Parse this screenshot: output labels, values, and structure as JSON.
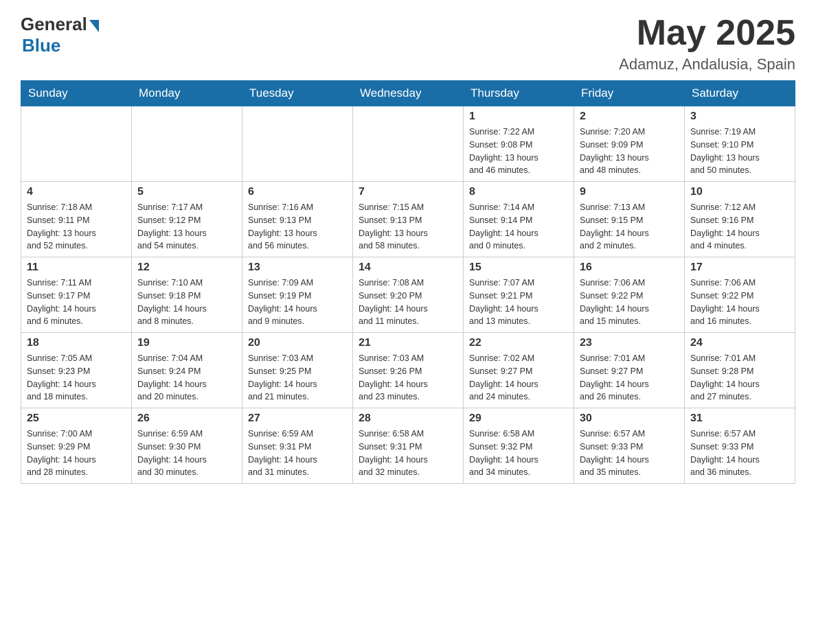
{
  "header": {
    "logo_general": "General",
    "logo_blue": "Blue",
    "month_title": "May 2025",
    "location": "Adamuz, Andalusia, Spain"
  },
  "weekdays": [
    "Sunday",
    "Monday",
    "Tuesday",
    "Wednesday",
    "Thursday",
    "Friday",
    "Saturday"
  ],
  "weeks": [
    [
      {
        "day": "",
        "info": ""
      },
      {
        "day": "",
        "info": ""
      },
      {
        "day": "",
        "info": ""
      },
      {
        "day": "",
        "info": ""
      },
      {
        "day": "1",
        "info": "Sunrise: 7:22 AM\nSunset: 9:08 PM\nDaylight: 13 hours\nand 46 minutes."
      },
      {
        "day": "2",
        "info": "Sunrise: 7:20 AM\nSunset: 9:09 PM\nDaylight: 13 hours\nand 48 minutes."
      },
      {
        "day": "3",
        "info": "Sunrise: 7:19 AM\nSunset: 9:10 PM\nDaylight: 13 hours\nand 50 minutes."
      }
    ],
    [
      {
        "day": "4",
        "info": "Sunrise: 7:18 AM\nSunset: 9:11 PM\nDaylight: 13 hours\nand 52 minutes."
      },
      {
        "day": "5",
        "info": "Sunrise: 7:17 AM\nSunset: 9:12 PM\nDaylight: 13 hours\nand 54 minutes."
      },
      {
        "day": "6",
        "info": "Sunrise: 7:16 AM\nSunset: 9:13 PM\nDaylight: 13 hours\nand 56 minutes."
      },
      {
        "day": "7",
        "info": "Sunrise: 7:15 AM\nSunset: 9:13 PM\nDaylight: 13 hours\nand 58 minutes."
      },
      {
        "day": "8",
        "info": "Sunrise: 7:14 AM\nSunset: 9:14 PM\nDaylight: 14 hours\nand 0 minutes."
      },
      {
        "day": "9",
        "info": "Sunrise: 7:13 AM\nSunset: 9:15 PM\nDaylight: 14 hours\nand 2 minutes."
      },
      {
        "day": "10",
        "info": "Sunrise: 7:12 AM\nSunset: 9:16 PM\nDaylight: 14 hours\nand 4 minutes."
      }
    ],
    [
      {
        "day": "11",
        "info": "Sunrise: 7:11 AM\nSunset: 9:17 PM\nDaylight: 14 hours\nand 6 minutes."
      },
      {
        "day": "12",
        "info": "Sunrise: 7:10 AM\nSunset: 9:18 PM\nDaylight: 14 hours\nand 8 minutes."
      },
      {
        "day": "13",
        "info": "Sunrise: 7:09 AM\nSunset: 9:19 PM\nDaylight: 14 hours\nand 9 minutes."
      },
      {
        "day": "14",
        "info": "Sunrise: 7:08 AM\nSunset: 9:20 PM\nDaylight: 14 hours\nand 11 minutes."
      },
      {
        "day": "15",
        "info": "Sunrise: 7:07 AM\nSunset: 9:21 PM\nDaylight: 14 hours\nand 13 minutes."
      },
      {
        "day": "16",
        "info": "Sunrise: 7:06 AM\nSunset: 9:22 PM\nDaylight: 14 hours\nand 15 minutes."
      },
      {
        "day": "17",
        "info": "Sunrise: 7:06 AM\nSunset: 9:22 PM\nDaylight: 14 hours\nand 16 minutes."
      }
    ],
    [
      {
        "day": "18",
        "info": "Sunrise: 7:05 AM\nSunset: 9:23 PM\nDaylight: 14 hours\nand 18 minutes."
      },
      {
        "day": "19",
        "info": "Sunrise: 7:04 AM\nSunset: 9:24 PM\nDaylight: 14 hours\nand 20 minutes."
      },
      {
        "day": "20",
        "info": "Sunrise: 7:03 AM\nSunset: 9:25 PM\nDaylight: 14 hours\nand 21 minutes."
      },
      {
        "day": "21",
        "info": "Sunrise: 7:03 AM\nSunset: 9:26 PM\nDaylight: 14 hours\nand 23 minutes."
      },
      {
        "day": "22",
        "info": "Sunrise: 7:02 AM\nSunset: 9:27 PM\nDaylight: 14 hours\nand 24 minutes."
      },
      {
        "day": "23",
        "info": "Sunrise: 7:01 AM\nSunset: 9:27 PM\nDaylight: 14 hours\nand 26 minutes."
      },
      {
        "day": "24",
        "info": "Sunrise: 7:01 AM\nSunset: 9:28 PM\nDaylight: 14 hours\nand 27 minutes."
      }
    ],
    [
      {
        "day": "25",
        "info": "Sunrise: 7:00 AM\nSunset: 9:29 PM\nDaylight: 14 hours\nand 28 minutes."
      },
      {
        "day": "26",
        "info": "Sunrise: 6:59 AM\nSunset: 9:30 PM\nDaylight: 14 hours\nand 30 minutes."
      },
      {
        "day": "27",
        "info": "Sunrise: 6:59 AM\nSunset: 9:31 PM\nDaylight: 14 hours\nand 31 minutes."
      },
      {
        "day": "28",
        "info": "Sunrise: 6:58 AM\nSunset: 9:31 PM\nDaylight: 14 hours\nand 32 minutes."
      },
      {
        "day": "29",
        "info": "Sunrise: 6:58 AM\nSunset: 9:32 PM\nDaylight: 14 hours\nand 34 minutes."
      },
      {
        "day": "30",
        "info": "Sunrise: 6:57 AM\nSunset: 9:33 PM\nDaylight: 14 hours\nand 35 minutes."
      },
      {
        "day": "31",
        "info": "Sunrise: 6:57 AM\nSunset: 9:33 PM\nDaylight: 14 hours\nand 36 minutes."
      }
    ]
  ]
}
